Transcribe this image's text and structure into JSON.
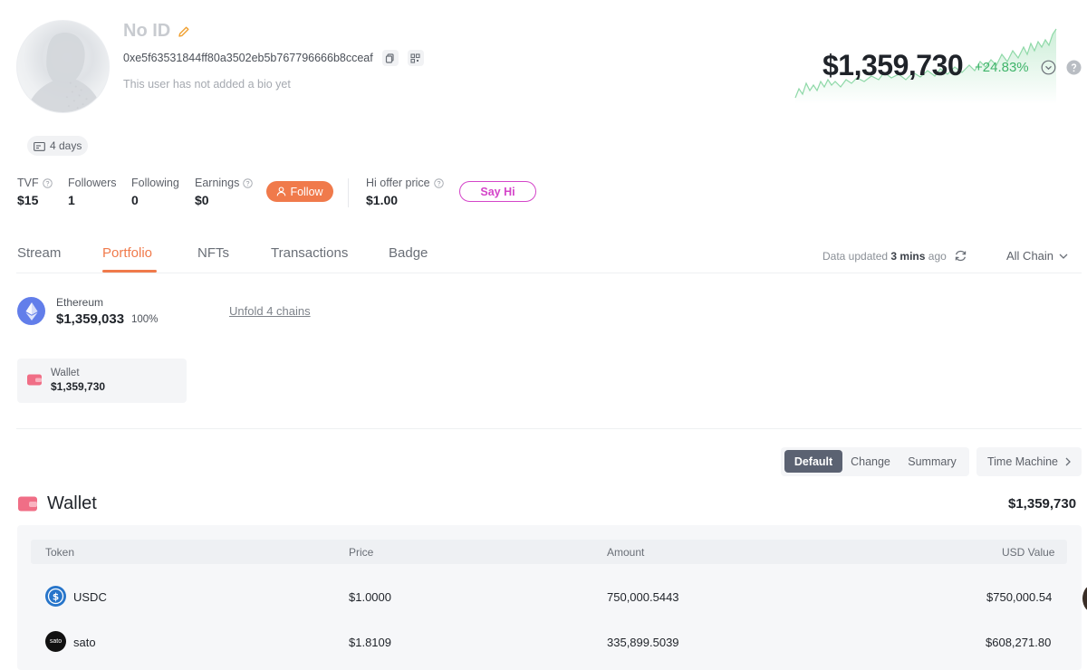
{
  "profile": {
    "name": "No ID",
    "address": "0xe5f63531844ff80a3502eb5b767796666b8cceaf",
    "bio": "This user has not added a bio yet",
    "days_badge": "4 days"
  },
  "stats": {
    "tvf_label": "TVF",
    "tvf_value": "$15",
    "followers_label": "Followers",
    "followers_value": "1",
    "following_label": "Following",
    "following_value": "0",
    "earnings_label": "Earnings",
    "earnings_value": "$0",
    "hi_offer_label": "Hi offer price",
    "hi_offer_value": "$1.00"
  },
  "actions": {
    "follow_label": "Follow",
    "say_hi_label": "Say Hi"
  },
  "net_worth": {
    "value": "$1,359,730",
    "change": "+24.83%",
    "change_color": "#3fb46a"
  },
  "tabs": [
    {
      "label": "Stream"
    },
    {
      "label": "Portfolio",
      "active": true
    },
    {
      "label": "NFTs"
    },
    {
      "label": "Transactions"
    },
    {
      "label": "Badge"
    }
  ],
  "data_updated": {
    "prefix": "Data updated",
    "time": "3 mins",
    "suffix": "ago"
  },
  "chain_filter": "All Chain",
  "chain_summary": {
    "name": "Ethereum",
    "value": "$1,359,033",
    "percent": "100%",
    "unfold_label": "Unfold 4 chains"
  },
  "wallet_card": {
    "label": "Wallet",
    "value": "$1,359,730"
  },
  "view_toggles": {
    "default": "Default",
    "change": "Change",
    "summary": "Summary",
    "time_machine": "Time Machine"
  },
  "wallet_section": {
    "title": "Wallet",
    "total": "$1,359,730",
    "columns": [
      "Token",
      "Price",
      "Amount",
      "USD Value"
    ],
    "rows": [
      {
        "token": "USDC",
        "icon": "usdc-icon",
        "price": "$1.0000",
        "amount": "750,000.5443",
        "usd_value": "$750,000.54"
      },
      {
        "token": "sato",
        "icon": "sato-icon",
        "icon_text": "sato",
        "price": "$1.8109",
        "amount": "335,899.5039",
        "usd_value": "$608,271.80"
      }
    ]
  },
  "colors": {
    "accent": "#f07a4b",
    "say_hi": "#d445c9",
    "ethereum": "#627eea",
    "usdc": "#2775ca",
    "wallet_icon": "#f06e86"
  }
}
